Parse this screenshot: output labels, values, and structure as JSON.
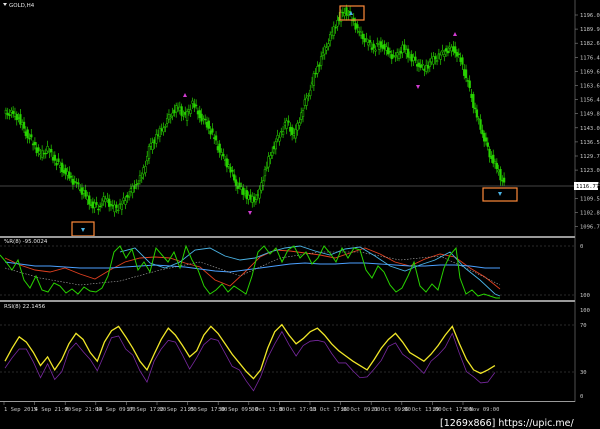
{
  "chart_data": [
    {
      "type": "candlestick",
      "title": "GOLD,H4",
      "series": [
        {
          "name": "GOLD,H4",
          "close": [
            1150,
            1148,
            1141,
            1136,
            1130,
            1133,
            1128,
            1124,
            1120,
            1116,
            1112,
            1107,
            1106,
            1110,
            1105,
            1106,
            1111,
            1116,
            1120,
            1133,
            1139,
            1144,
            1150,
            1153,
            1148,
            1155,
            1149,
            1145,
            1138,
            1130,
            1125,
            1117,
            1113,
            1109,
            1110,
            1123,
            1133,
            1140,
            1146,
            1139,
            1150,
            1160,
            1170,
            1178,
            1186,
            1194,
            1199,
            1195,
            1188,
            1184,
            1181,
            1183,
            1179,
            1176,
            1181,
            1177,
            1174,
            1171,
            1175,
            1177,
            1180,
            1181,
            1175,
            1164,
            1151,
            1141,
            1131,
            1124,
            1116
          ]
        }
      ],
      "ylim": [
        1092,
        1200
      ],
      "ticks": {
        "y": [
          "1196.05",
          "1189.95",
          "1182.65",
          "1176.45",
          "1169.65",
          "1163.65",
          "1156.45",
          "1149.85",
          "1143.05",
          "1136.50",
          "1129.75",
          "1123.00",
          "1116.20",
          "1109.50",
          "1102.80",
          "1096.75"
        ],
        "x": [
          "1 Sep 2015",
          "4 Sep 21:00",
          "9 Sep 21:00",
          "14 Sep 09:00",
          "17 Sep 17:00",
          "22 Sep 21:00",
          "25 Sep 17:00",
          "30 Sep 09:00",
          "5 Oct 13:00",
          "8 Oct 17:00",
          "13 Oct 17:00",
          "16 Oct 09:00",
          "21 Oct 09:00",
          "26 Oct 13:00",
          "29 Oct 17:00",
          "3 Nov 09:00"
        ]
      },
      "current_price": "1116.77"
    },
    {
      "type": "line",
      "title": "%R(8) -95.0024",
      "ticks": {
        "y": [
          "0",
          "100"
        ]
      },
      "grid": true
    },
    {
      "type": "line",
      "title": "RSI(8) 22.1456",
      "ticks": {
        "y": [
          "100",
          "70",
          "30",
          "0"
        ]
      },
      "grid": true
    }
  ],
  "watermark": "[1269x866] https://upic.me/",
  "colors": {
    "background": "#000000",
    "candle": "#28d200",
    "arrow_magenta": "#d23cd2",
    "arrow_cyan": "#4bb4e6",
    "highlight_box": "#ff8a3a",
    "pct_r": "#28d200",
    "rsi": "#f0e628",
    "rsi_shadow": "#7828a0"
  }
}
